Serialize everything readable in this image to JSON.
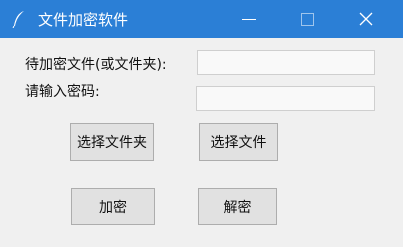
{
  "window": {
    "title": "文件加密软件",
    "titlebar_color": "#2b7fd6",
    "controls": {
      "minimize": "minimize-icon",
      "maximize": "maximize-icon",
      "close": "close-icon",
      "close_glyph": "✕"
    },
    "app_icon": "feather-icon"
  },
  "form": {
    "file_label": "待加密文件(或文件夹):",
    "file_value": "",
    "password_label": "请输入密码:",
    "password_value": ""
  },
  "buttons": {
    "select_folder": "选择文件夹",
    "select_file": "选择文件",
    "encrypt": "加密",
    "decrypt": "解密"
  }
}
